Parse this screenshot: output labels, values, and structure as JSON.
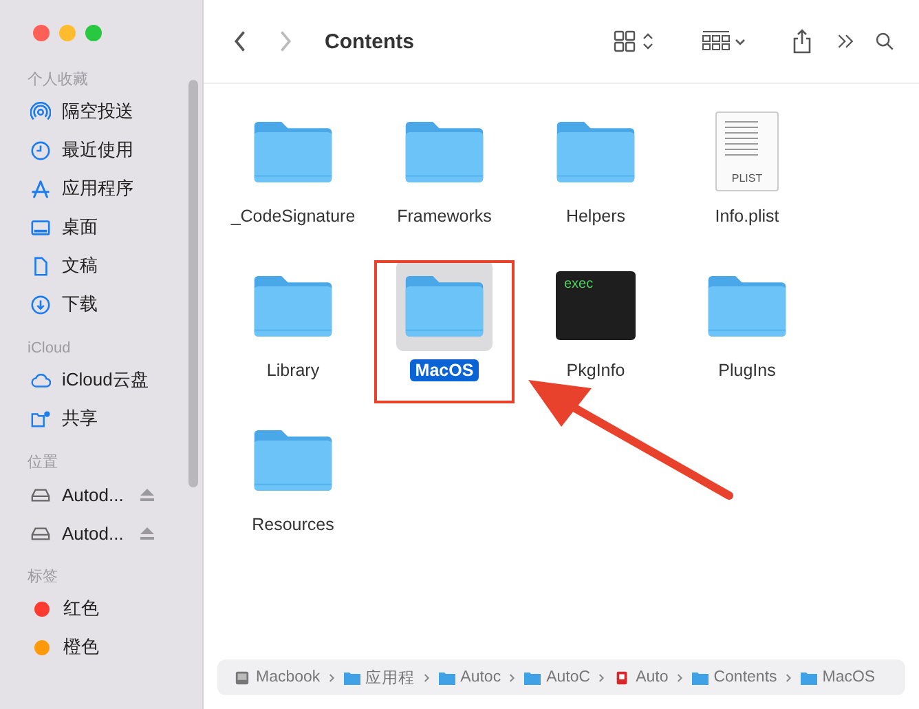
{
  "window": {
    "title": "Contents"
  },
  "sidebar": {
    "sections": [
      {
        "title": "个人收藏",
        "items": [
          {
            "kind": "airdrop",
            "label": "隔空投送"
          },
          {
            "kind": "recent",
            "label": "最近使用"
          },
          {
            "kind": "apps",
            "label": "应用程序"
          },
          {
            "kind": "desktop",
            "label": "桌面"
          },
          {
            "kind": "document",
            "label": "文稿"
          },
          {
            "kind": "download",
            "label": "下载"
          }
        ]
      },
      {
        "title": "iCloud",
        "items": [
          {
            "kind": "cloud",
            "label": "iCloud云盘"
          },
          {
            "kind": "shared",
            "label": "共享"
          }
        ]
      },
      {
        "title": "位置",
        "items": [
          {
            "kind": "drive",
            "label": "Autod..."
          },
          {
            "kind": "drive",
            "label": "Autod..."
          }
        ]
      },
      {
        "title": "标签",
        "items": [
          {
            "kind": "tag",
            "label": "红色",
            "color": "#fe3b30"
          },
          {
            "kind": "tag",
            "label": "橙色",
            "color": "#fe9a0a"
          }
        ]
      }
    ]
  },
  "files": [
    {
      "kind": "folder",
      "name": "_CodeSignature",
      "selected": false
    },
    {
      "kind": "folder",
      "name": "Frameworks",
      "selected": false
    },
    {
      "kind": "folder",
      "name": "Helpers",
      "selected": false
    },
    {
      "kind": "plist",
      "name": "Info.plist",
      "badge": "PLIST",
      "selected": false
    },
    {
      "kind": "folder",
      "name": "Library",
      "selected": false
    },
    {
      "kind": "folder",
      "name": "MacOS",
      "selected": true,
      "highlighted": true
    },
    {
      "kind": "exec",
      "name": "PkgInfo",
      "badge": "exec",
      "selected": false
    },
    {
      "kind": "folder",
      "name": "PlugIns",
      "selected": false
    },
    {
      "kind": "folder",
      "name": "Resources",
      "selected": false
    }
  ],
  "path_bar": [
    {
      "kind": "disk",
      "label": "Macbook"
    },
    {
      "kind": "folder",
      "label": "应用程"
    },
    {
      "kind": "folder",
      "label": "Autoc"
    },
    {
      "kind": "folder",
      "label": "AutoC"
    },
    {
      "kind": "app",
      "label": "Auto"
    },
    {
      "kind": "folder",
      "label": "Contents"
    },
    {
      "kind": "folder",
      "label": "MacOS"
    }
  ]
}
